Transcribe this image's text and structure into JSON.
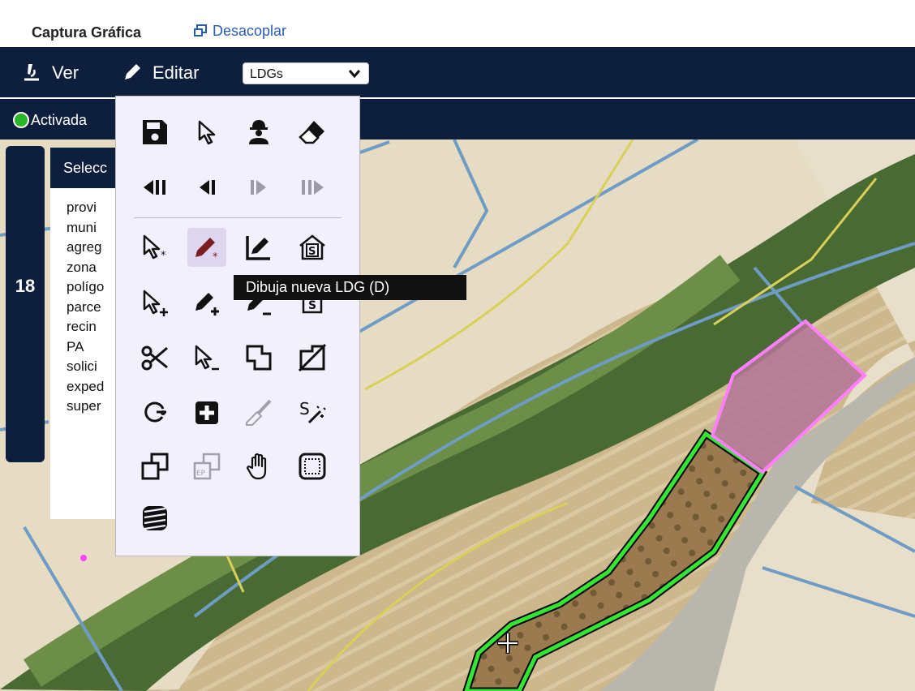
{
  "header": {
    "title": "Captura Gráfica",
    "undock_label": "Desacoplar"
  },
  "toolbar": {
    "view_label": "Ver",
    "edit_label": "Editar",
    "layer_select": {
      "value": "LDGs"
    }
  },
  "status": {
    "label": "Activada",
    "color": "#2bb52b"
  },
  "side_tab": {
    "number": "18"
  },
  "info_panel": {
    "header": "Selecc",
    "rows": [
      "provi",
      "muni",
      "agreg",
      "zona",
      "polígo",
      "parce",
      "recin",
      "PA",
      "solici",
      "exped",
      "super"
    ]
  },
  "tool_palette": {
    "tools": [
      {
        "name": "save-icon",
        "enabled": true
      },
      {
        "name": "select-arrow-icon",
        "enabled": true
      },
      {
        "name": "worker-icon",
        "enabled": true
      },
      {
        "name": "eraser-icon",
        "enabled": true
      },
      {
        "name": "first-step-icon",
        "enabled": true
      },
      {
        "name": "previous-step-icon",
        "enabled": true
      },
      {
        "name": "next-step-icon",
        "enabled": false
      },
      {
        "name": "last-step-icon",
        "enabled": false
      },
      {
        "name": "select-star-icon",
        "enabled": true
      },
      {
        "name": "draw-new-ldg-icon",
        "enabled": true,
        "active": true
      },
      {
        "name": "edit-vertex-icon",
        "enabled": true
      },
      {
        "name": "house-s-icon",
        "enabled": true
      },
      {
        "name": "select-add-icon",
        "enabled": true
      },
      {
        "name": "pencil-add-icon",
        "enabled": true
      },
      {
        "name": "pencil-remove-icon",
        "enabled": true
      },
      {
        "name": "square-s-icon",
        "enabled": true
      },
      {
        "name": "scissors-icon",
        "enabled": true
      },
      {
        "name": "select-remove-icon",
        "enabled": true
      },
      {
        "name": "merge-shapes-icon",
        "enabled": true
      },
      {
        "name": "delete-shape-icon",
        "enabled": true
      },
      {
        "name": "rotate-icon",
        "enabled": true
      },
      {
        "name": "add-box-icon",
        "enabled": true
      },
      {
        "name": "brush-icon",
        "enabled": false
      },
      {
        "name": "magic-s-icon",
        "enabled": true
      },
      {
        "name": "copy-icon",
        "enabled": true
      },
      {
        "name": "copy-ep-icon",
        "enabled": false
      },
      {
        "name": "hand-icon",
        "enabled": true
      },
      {
        "name": "dashed-square-icon",
        "enabled": true
      },
      {
        "name": "stripes-icon",
        "enabled": true
      }
    ],
    "tooltip": "Dibuja nueva LDG (D)"
  },
  "map": {
    "accent_green": "#33e633",
    "accent_pink": "#ff7fff",
    "parcel_line": "#6f9cc4",
    "boundary_line": "#d9d05a"
  }
}
